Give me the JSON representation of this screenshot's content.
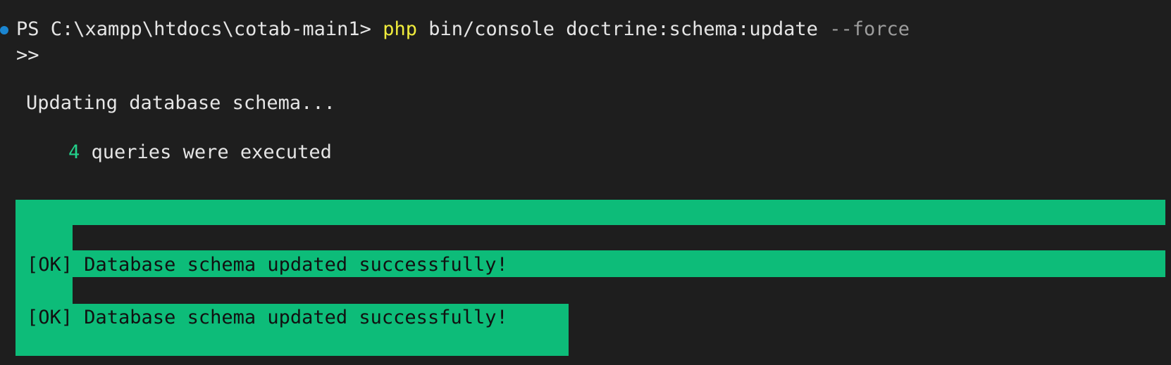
{
  "terminal": {
    "prompt": "PS C:\\xampp\\htdocs\\cotab-main1>",
    "command_php": "php",
    "command_args": "bin/console doctrine:schema:update",
    "command_flag": "--force",
    "continuation": ">>",
    "updating_text": "Updating database schema...",
    "query_count": "4",
    "queries_text": "queries were executed",
    "ok_message_1": "[OK] Database schema updated successfully!",
    "ok_message_2": "[OK] Database schema updated successfully!"
  },
  "colors": {
    "background": "#1e1e1e",
    "prompt_dot": "#1a85d0",
    "php_keyword": "#f0ec3c",
    "flag": "#9d9d9d",
    "count": "#23d18b",
    "ok_background": "#0dbc79"
  }
}
